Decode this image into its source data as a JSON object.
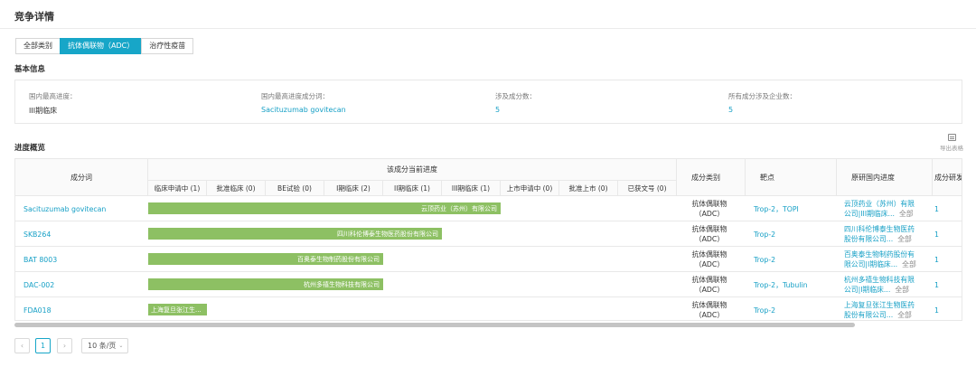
{
  "page": {
    "title": "竞争详情"
  },
  "tabs": [
    {
      "label": "全部类别",
      "active": false
    },
    {
      "label": "抗体偶联物（ADC）",
      "active": true
    },
    {
      "label": "治疗性疫苗",
      "active": false
    }
  ],
  "basic_info": {
    "section_title": "基本信息",
    "fields": [
      {
        "label": "国内最高进度：",
        "value": "III期临床"
      },
      {
        "label": "国内最高进度成分词：",
        "value": "Sacituzumab govitecan"
      },
      {
        "label": "涉及成分数：",
        "value": "5"
      },
      {
        "label": "所有成分涉及企业数：",
        "value": "5"
      }
    ]
  },
  "progress": {
    "section_title": "进度概览",
    "export_label": "导出表格",
    "columns": {
      "component": "成分词",
      "current_progress": "该成分当前进度",
      "category": "成分类别",
      "target": "靶点",
      "domestic": "原研国内进度",
      "research": "成分研发"
    },
    "stages": [
      "临床申请中 (1)",
      "批准临床 (0)",
      "BE试验 (0)",
      "I期临床 (2)",
      "II期临床 (1)",
      "III期临床 (1)",
      "上市申请中 (0)",
      "批准上市 (0)",
      "已获文号 (0)"
    ],
    "rows": [
      {
        "component": "Sacituzumab govitecan",
        "bar_label": "云顶药业（苏州）有限公司",
        "bar_stage_index": 5,
        "category": "抗体偶联物（ADC）",
        "target": "Trop-2，TOPI",
        "domestic_line1": "云顶药业（苏州）有限",
        "domestic_line2": "公司|III期临床...",
        "all_label": "全部",
        "research": "1"
      },
      {
        "component": "SKB264",
        "bar_label": "四川科伦博泰生物医药股份有限公司",
        "bar_stage_index": 4,
        "category": "抗体偶联物（ADC）",
        "target": "Trop-2",
        "domestic_line1": "四川科伦博泰生物医药",
        "domestic_line2": "股份有限公司...",
        "all_label": "全部",
        "research": "1"
      },
      {
        "component": "BAT 8003",
        "bar_label": "百奥泰生物制药股份有限公司",
        "bar_stage_index": 3,
        "category": "抗体偶联物（ADC）",
        "target": "Trop-2",
        "domestic_line1": "百奥泰生物制药股份有",
        "domestic_line2": "限公司|I期临床...",
        "all_label": "全部",
        "research": "1"
      },
      {
        "component": "DAC-002",
        "bar_label": "杭州多禧生物科技有限公司",
        "bar_stage_index": 3,
        "category": "抗体偶联物（ADC）",
        "target": "Trop-2，Tubulin",
        "domestic_line1": "杭州多禧生物科技有限",
        "domestic_line2": "公司|I期临床...",
        "all_label": "全部",
        "research": "1"
      },
      {
        "component": "FDA018",
        "bar_label": "上海复旦张江生...",
        "bar_stage_index": 0,
        "category": "抗体偶联物（ADC）",
        "target": "Trop-2",
        "domestic_line1": "上海复旦张江生物医药",
        "domestic_line2": "股份有限公司...",
        "all_label": "全部",
        "research": "1"
      }
    ]
  },
  "pagination": {
    "prev": "‹",
    "current": "1",
    "next": "›",
    "page_size": "10 条/页"
  },
  "colors": {
    "accent": "#17a6c8",
    "link": "#17a0c6",
    "bar": "#8dc063"
  }
}
